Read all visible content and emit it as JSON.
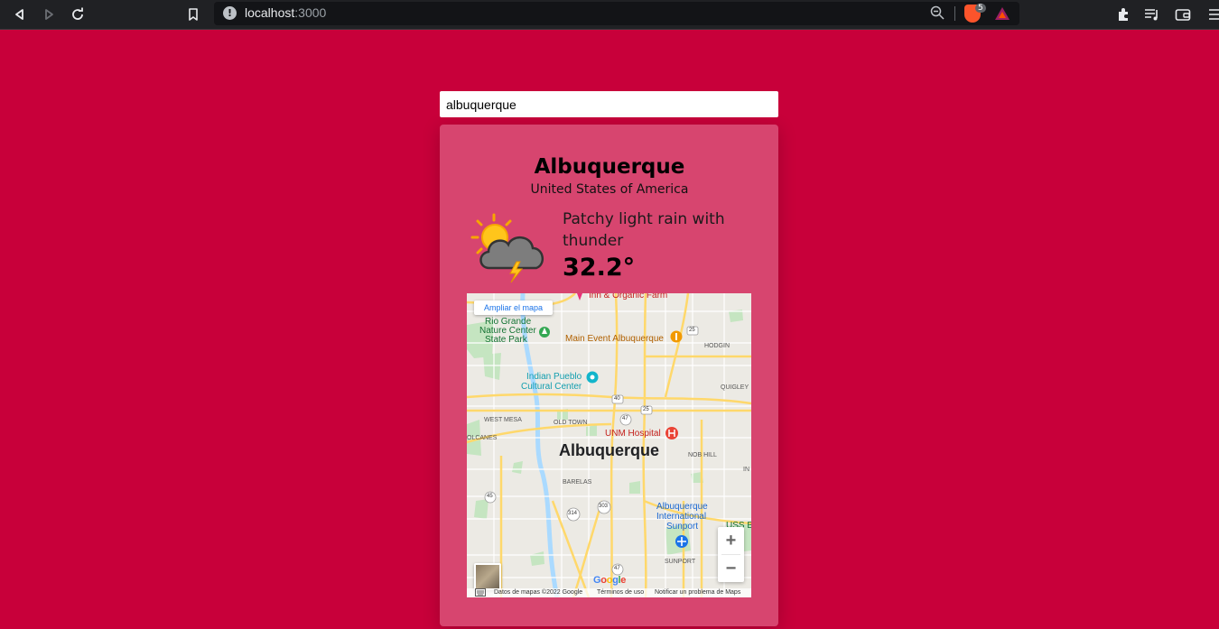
{
  "browser": {
    "url_host": "localhost",
    "url_port": ":3000",
    "brave_badge": "5"
  },
  "search": {
    "value": "albuquerque"
  },
  "weather": {
    "city": "Albuquerque",
    "country": "United States of America",
    "condition": "Patchy light rain with thunder",
    "temperature": "32.2°",
    "icon": "sun-cloud-thunder-icon"
  },
  "map": {
    "enlarge_label": "Ampliar el mapa",
    "zoom_in": "+",
    "zoom_out": "−",
    "city_label": "Albuquerque",
    "places": {
      "top_partial": "Inn & Organic Farm",
      "rio_grande_1": "Rio Grande",
      "rio_grande_2": "Nature Center",
      "rio_grande_3": "State Park",
      "main_event": "Main Event Albuquerque",
      "indian_pueblo_1": "Indian Pueblo",
      "indian_pueblo_2": "Cultural Center",
      "unm_hospital": "UNM Hospital",
      "airport_1": "Albuquerque",
      "airport_2": "International",
      "airport_3": "Sunport",
      "uss_partial": "USS B"
    },
    "districts": {
      "hodgin": "HODGIN",
      "quigley": "QUIGLEY",
      "west_mesa": "WEST MESA",
      "old_town": "OLD TOWN",
      "volcanes": "OLCANES",
      "nob_hill": "NOB HILL",
      "barelas": "BARELAS",
      "sunport": "SUNPORT",
      "in_partial": "IN"
    },
    "shields": {
      "i40": "40",
      "i25_top": "25",
      "i25_mid": "25",
      "r47_mid": "47",
      "r45": "45",
      "r314": "314",
      "r303": "303",
      "r47_bot": "47"
    },
    "google": "Google",
    "footer": {
      "data": "Datos de mapas ©2022 Google",
      "terms": "Términos de uso",
      "report": "Notificar un problema de Maps"
    }
  }
}
